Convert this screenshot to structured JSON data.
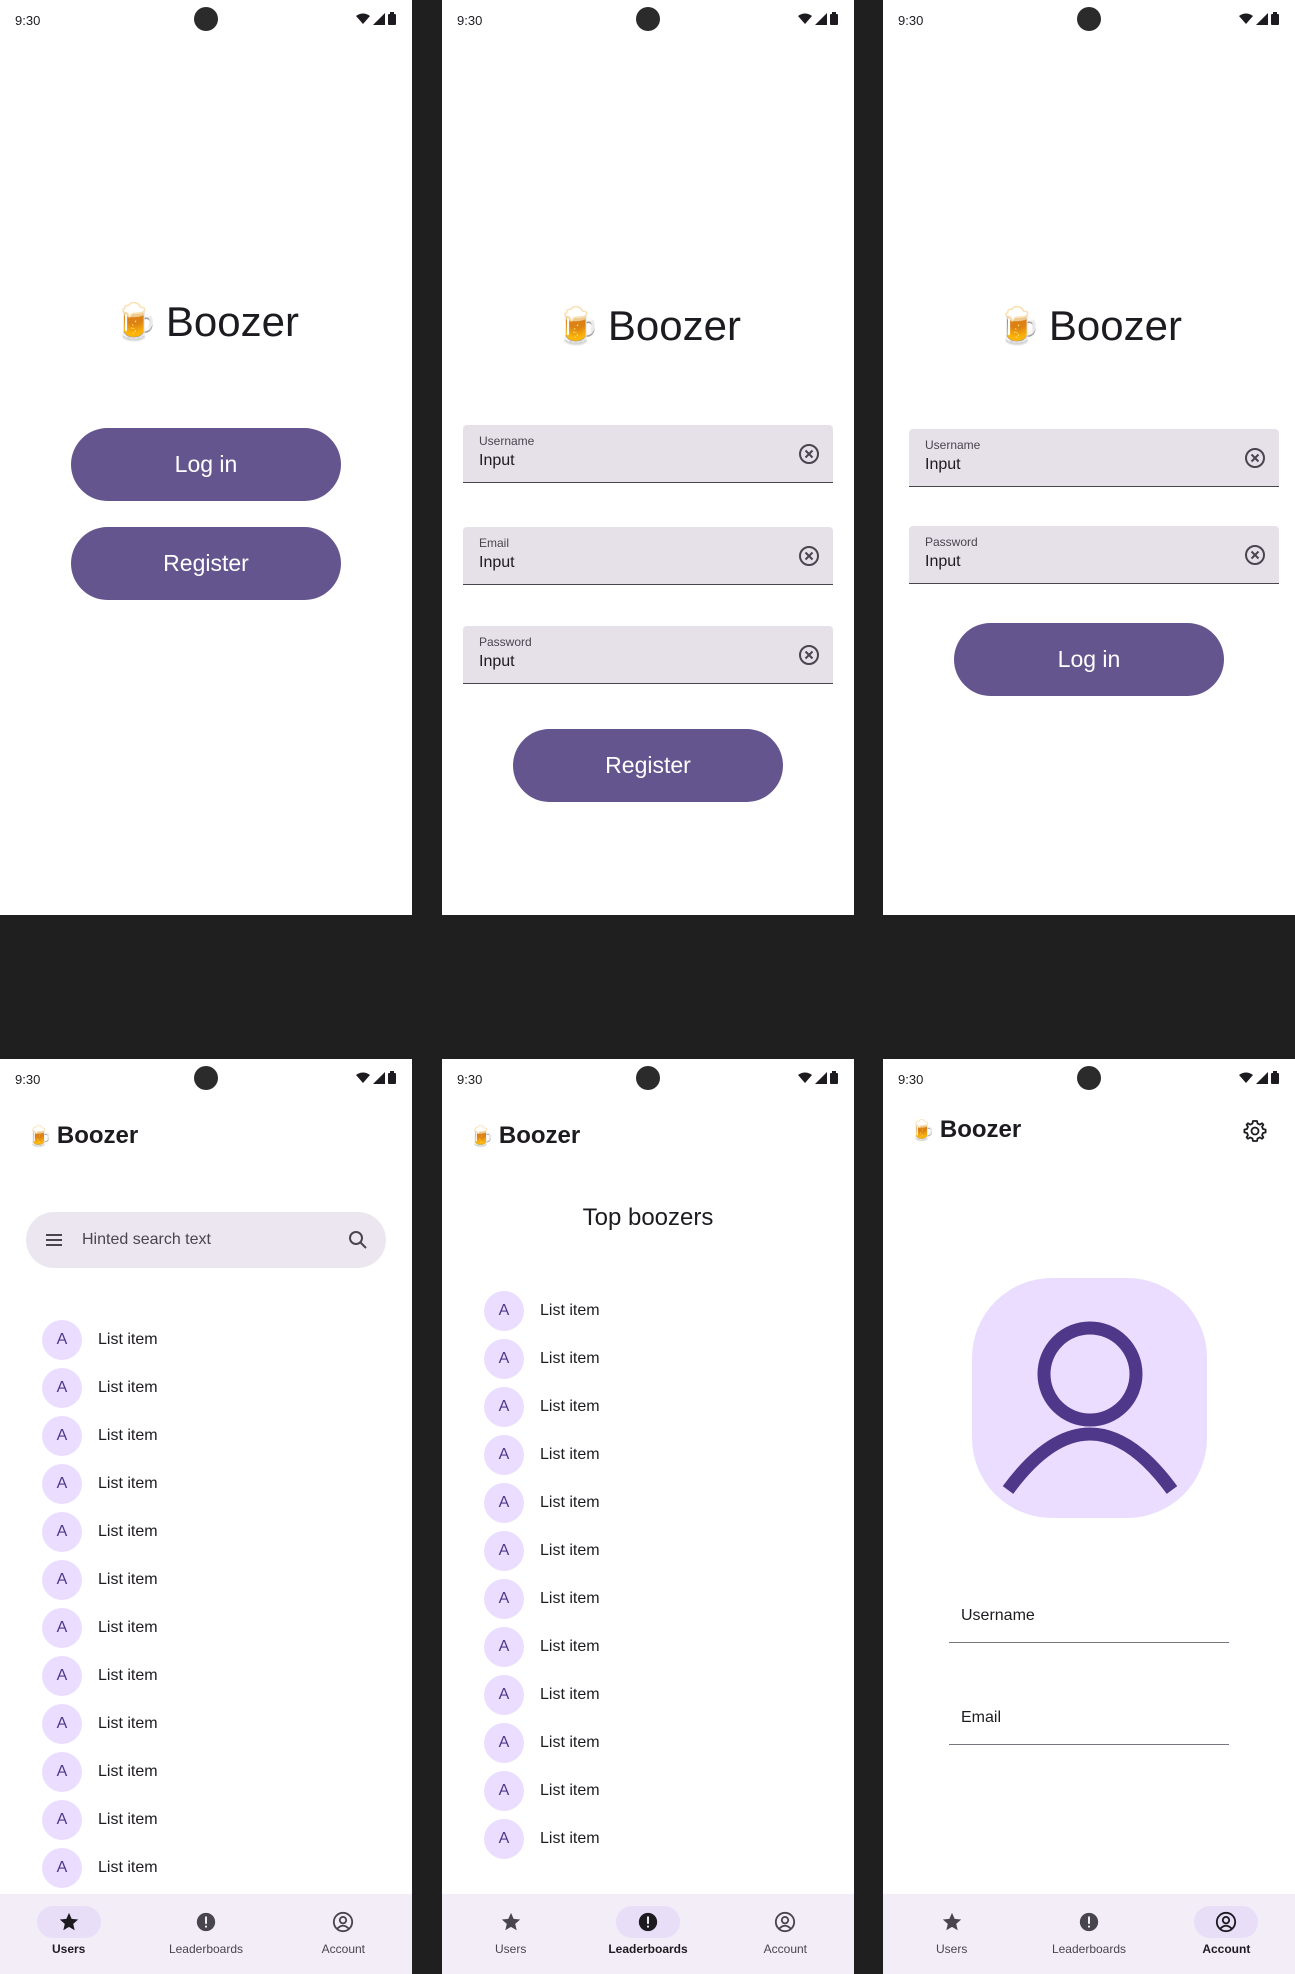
{
  "status": {
    "time": "9:30"
  },
  "app": {
    "name": "Boozer",
    "logo_emoji": "🍺"
  },
  "welcome": {
    "login_label": "Log in",
    "register_label": "Register"
  },
  "register": {
    "fields": [
      {
        "label": "Username",
        "value": "Input"
      },
      {
        "label": "Email",
        "value": "Input"
      },
      {
        "label": "Password",
        "value": "Input"
      }
    ],
    "submit_label": "Register"
  },
  "login": {
    "fields": [
      {
        "label": "Username",
        "value": "Input"
      },
      {
        "label": "Password",
        "value": "Input"
      }
    ],
    "submit_label": "Log in"
  },
  "users": {
    "search_placeholder": "Hinted search text",
    "avatar_letter": "A",
    "item_label": "List item"
  },
  "leaderboards": {
    "title": "Top boozers",
    "avatar_letter": "A",
    "item_label": "List item"
  },
  "account": {
    "username_label": "Username",
    "email_label": "Email"
  },
  "nav": {
    "users": "Users",
    "leaderboards": "Leaderboards",
    "account": "Account"
  },
  "colors": {
    "primary": "#65558f",
    "surface_variant": "#e6e0e9",
    "avatar_bg": "#eaddff",
    "nav_bg": "#f3edf7",
    "nav_active": "#e8def8"
  }
}
